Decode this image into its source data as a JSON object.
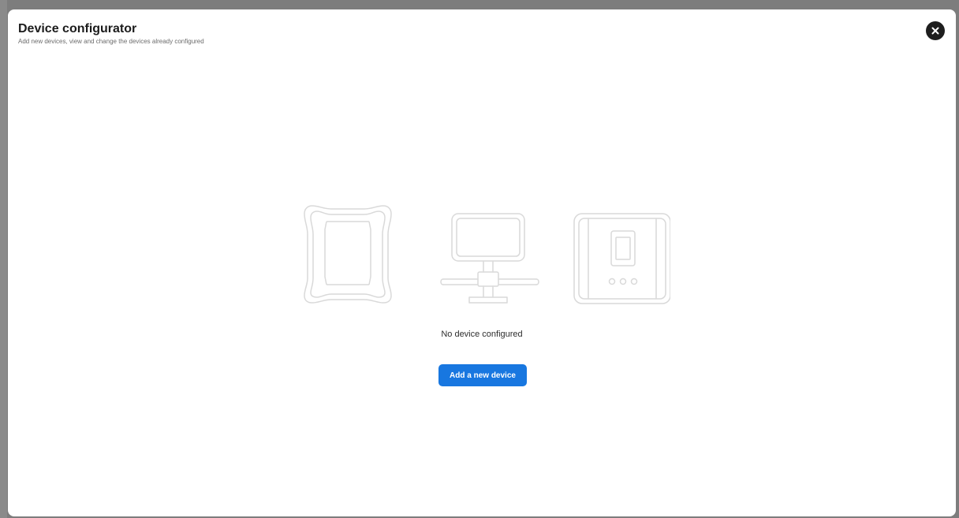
{
  "modal": {
    "title": "Device configurator",
    "subtitle": "Add new devices, view and change the devices already configured",
    "close_icon": "close-icon"
  },
  "empty_state": {
    "icons": [
      "enclosure-device-icon",
      "network-device-icon",
      "controller-device-icon"
    ],
    "message": "No device configured",
    "add_button_label": "Add a new device"
  },
  "colors": {
    "backdrop": "#7d7d7d",
    "modal_background": "#ffffff",
    "primary_button": "#1877e0",
    "close_button": "#1e1e1e",
    "illustration_stroke": "#d9d9d9"
  }
}
